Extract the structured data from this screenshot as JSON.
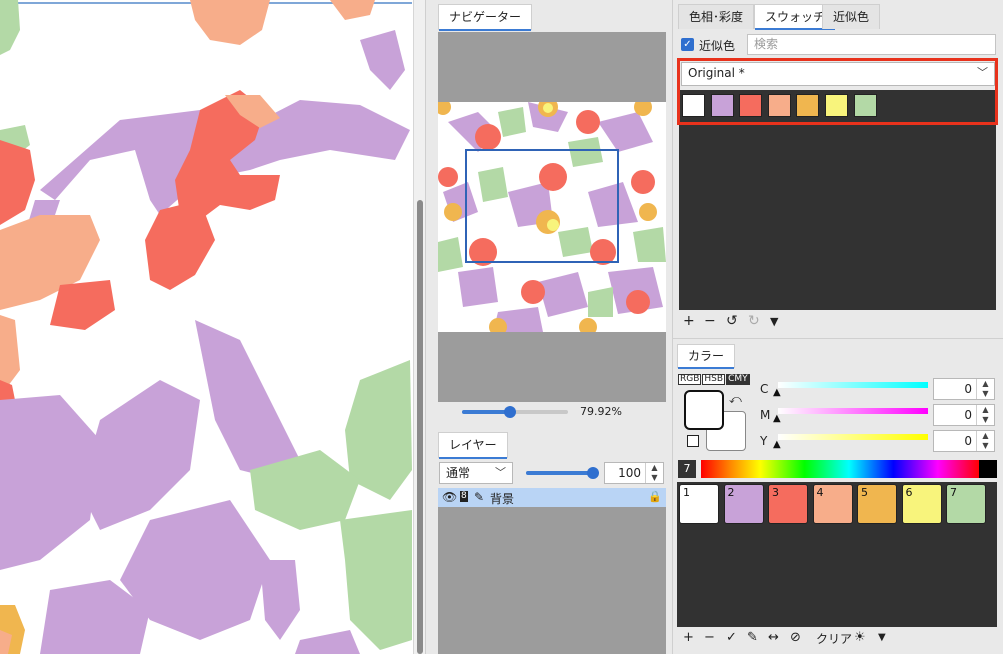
{
  "navigator": {
    "tab_label": "ナビゲーター",
    "zoom_level": "79.92%",
    "zoom_fraction": 0.45
  },
  "layers": {
    "tab_label": "レイヤー",
    "blend_mode": "通常",
    "opacity": "100",
    "opacity_fraction": 0.95,
    "rows": [
      {
        "name": "背景",
        "icons": [
          "eye-icon",
          "bit-depth-icon",
          "pencil-icon"
        ],
        "locked": true
      }
    ]
  },
  "swatch_panel": {
    "tabs": [
      "色相･彩度",
      "スウォッチ",
      "近似色"
    ],
    "active_tab": 1,
    "similar_checkbox_label": "近似色",
    "similar_checked": true,
    "search_placeholder": "検索",
    "swatch_set": "Original *",
    "colors": [
      "#ffffff",
      "#c8a2d8",
      "#f56c5e",
      "#f7ad8a",
      "#f0b64f",
      "#f8f47c",
      "#b3d9a6"
    ],
    "toolbar": [
      "add-icon",
      "remove-icon",
      "undo-icon",
      "redo-icon",
      "menu-down-icon"
    ]
  },
  "color_panel": {
    "tab_label": "カラー",
    "modes": [
      "RGB",
      "HSB",
      "CMY"
    ],
    "active_mode": "CMY",
    "channels": [
      {
        "label": "C",
        "value": "0",
        "gradient": [
          "#ffffff",
          "#00ffff"
        ]
      },
      {
        "label": "M",
        "value": "0",
        "gradient": [
          "#ffffff",
          "#ff00ff"
        ]
      },
      {
        "label": "Y",
        "value": "0",
        "gradient": [
          "#ffffff",
          "#ffff00"
        ]
      }
    ],
    "spectrum_number": "7",
    "mini_swatches": [
      {
        "num": "1",
        "color": "#ffffff"
      },
      {
        "num": "2",
        "color": "#c8a2d8"
      },
      {
        "num": "3",
        "color": "#f56c5e"
      },
      {
        "num": "4",
        "color": "#f7ad8a"
      },
      {
        "num": "5",
        "color": "#f0b64f"
      },
      {
        "num": "6",
        "color": "#f8f47c"
      },
      {
        "num": "7",
        "color": "#b3d9a6"
      }
    ],
    "bottom_toolbar": {
      "clear_label": "クリア"
    }
  }
}
